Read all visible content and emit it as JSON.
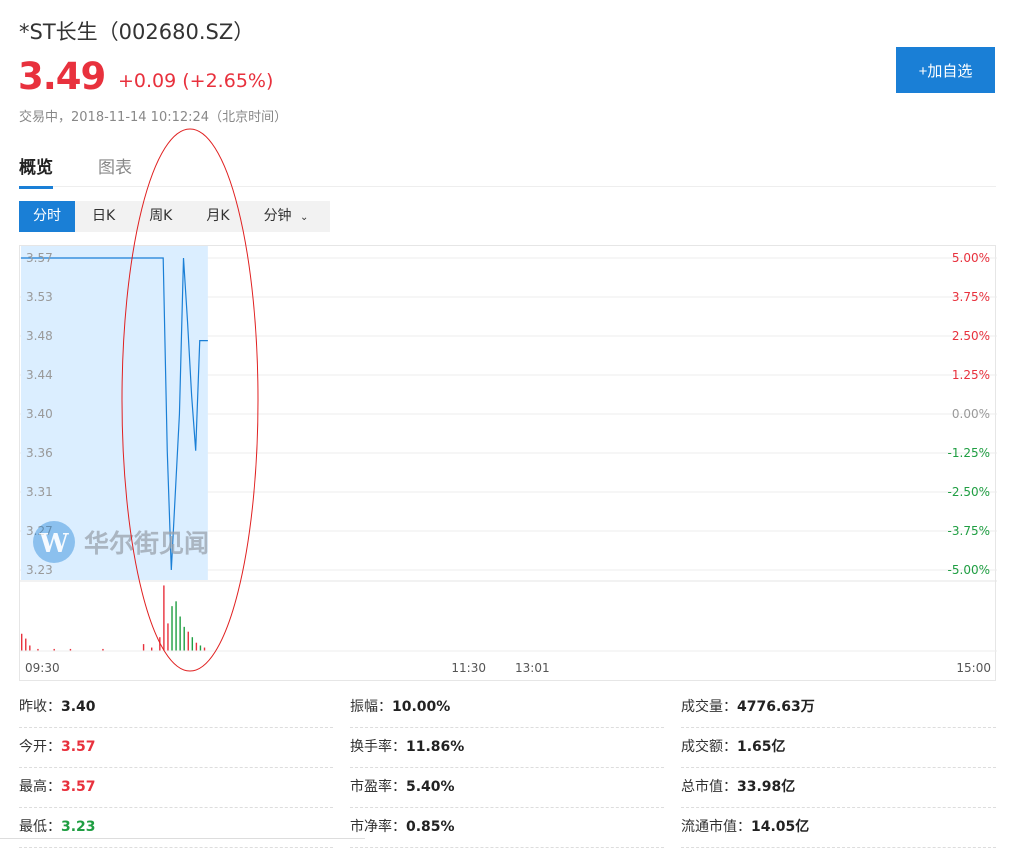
{
  "stock": {
    "title": "*ST长生（002680.SZ）",
    "price": "3.49",
    "change": "+0.09 (+2.65%)",
    "status": "交易中，2018-11-14 10:12:24（北京时间）"
  },
  "add_button": {
    "label": "+加自选"
  },
  "tabs": [
    {
      "label": "概览",
      "active": true
    },
    {
      "label": "图表",
      "active": false
    }
  ],
  "periods": [
    {
      "label": "分时",
      "active": true
    },
    {
      "label": "日K",
      "active": false
    },
    {
      "label": "周K",
      "active": false
    },
    {
      "label": "月K",
      "active": false
    },
    {
      "label": "分钟",
      "active": false,
      "dropdown": true
    }
  ],
  "chart_data": {
    "type": "line",
    "price_ticks": [
      "3.57",
      "3.53",
      "3.48",
      "3.44",
      "3.40",
      "3.36",
      "3.31",
      "3.27",
      "3.23"
    ],
    "pct_ticks": [
      "5.00%",
      "3.75%",
      "2.50%",
      "1.25%",
      "0.00%",
      "-1.25%",
      "-2.50%",
      "-3.75%",
      "-5.00%"
    ],
    "time_labels": [
      "09:30",
      "11:30",
      "13:01",
      "15:00"
    ],
    "ylim": [
      3.23,
      3.57
    ],
    "prev_close": 3.4,
    "total_minutes": 240,
    "price_series": [
      {
        "m": 0,
        "v": 3.57
      },
      {
        "m": 35,
        "v": 3.57
      },
      {
        "m": 36,
        "v": 3.36
      },
      {
        "m": 37,
        "v": 3.23
      },
      {
        "m": 39,
        "v": 3.4
      },
      {
        "m": 40,
        "v": 3.57
      },
      {
        "m": 41,
        "v": 3.5
      },
      {
        "m": 42,
        "v": 3.42
      },
      {
        "m": 43,
        "v": 3.36
      },
      {
        "m": 44,
        "v": 3.48
      },
      {
        "m": 46,
        "v": 3.48
      }
    ],
    "volume_series": [
      {
        "m": 0,
        "v": 0.25,
        "d": "up"
      },
      {
        "m": 1,
        "v": 0.18,
        "d": "up"
      },
      {
        "m": 2,
        "v": 0.08,
        "d": "up"
      },
      {
        "m": 4,
        "v": 0.03,
        "d": "up"
      },
      {
        "m": 8,
        "v": 0.03,
        "d": "up"
      },
      {
        "m": 12,
        "v": 0.03,
        "d": "up"
      },
      {
        "m": 20,
        "v": 0.03,
        "d": "up"
      },
      {
        "m": 30,
        "v": 0.1,
        "d": "up"
      },
      {
        "m": 32,
        "v": 0.05,
        "d": "up"
      },
      {
        "m": 34,
        "v": 0.2,
        "d": "up"
      },
      {
        "m": 35,
        "v": 0.95,
        "d": "up"
      },
      {
        "m": 36,
        "v": 0.4,
        "d": "up"
      },
      {
        "m": 37,
        "v": 0.65,
        "d": "down"
      },
      {
        "m": 38,
        "v": 0.72,
        "d": "down"
      },
      {
        "m": 39,
        "v": 0.5,
        "d": "down"
      },
      {
        "m": 40,
        "v": 0.35,
        "d": "down"
      },
      {
        "m": 41,
        "v": 0.28,
        "d": "up"
      },
      {
        "m": 42,
        "v": 0.2,
        "d": "down"
      },
      {
        "m": 43,
        "v": 0.12,
        "d": "up"
      },
      {
        "m": 44,
        "v": 0.08,
        "d": "down"
      },
      {
        "m": 45,
        "v": 0.05,
        "d": "up"
      }
    ],
    "colors": {
      "line": "#1a7fd6",
      "fill": "#dbeeff",
      "up": "#e8313d",
      "down": "#1f9e42",
      "neutral": "#999999"
    }
  },
  "watermark": {
    "text": "华尔街见闻"
  },
  "stats": {
    "col1": [
      {
        "label": "昨收：",
        "value": "3.40",
        "tone": ""
      },
      {
        "label": "今开：",
        "value": "3.57",
        "tone": "up"
      },
      {
        "label": "最高：",
        "value": "3.57",
        "tone": "up"
      },
      {
        "label": "最低：",
        "value": "3.23",
        "tone": "down"
      }
    ],
    "col2": [
      {
        "label": "振幅：",
        "value": "10.00%",
        "tone": ""
      },
      {
        "label": "换手率：",
        "value": "11.86%",
        "tone": ""
      },
      {
        "label": "市盈率：",
        "value": "5.40%",
        "tone": ""
      },
      {
        "label": "市净率：",
        "value": "0.85%",
        "tone": ""
      }
    ],
    "col3": [
      {
        "label": "成交量：",
        "value": "4776.63万",
        "tone": ""
      },
      {
        "label": "成交额：",
        "value": "1.65亿",
        "tone": ""
      },
      {
        "label": "总市值：",
        "value": "33.98亿",
        "tone": ""
      },
      {
        "label": "流通市值：",
        "value": "14.05亿",
        "tone": ""
      }
    ]
  }
}
